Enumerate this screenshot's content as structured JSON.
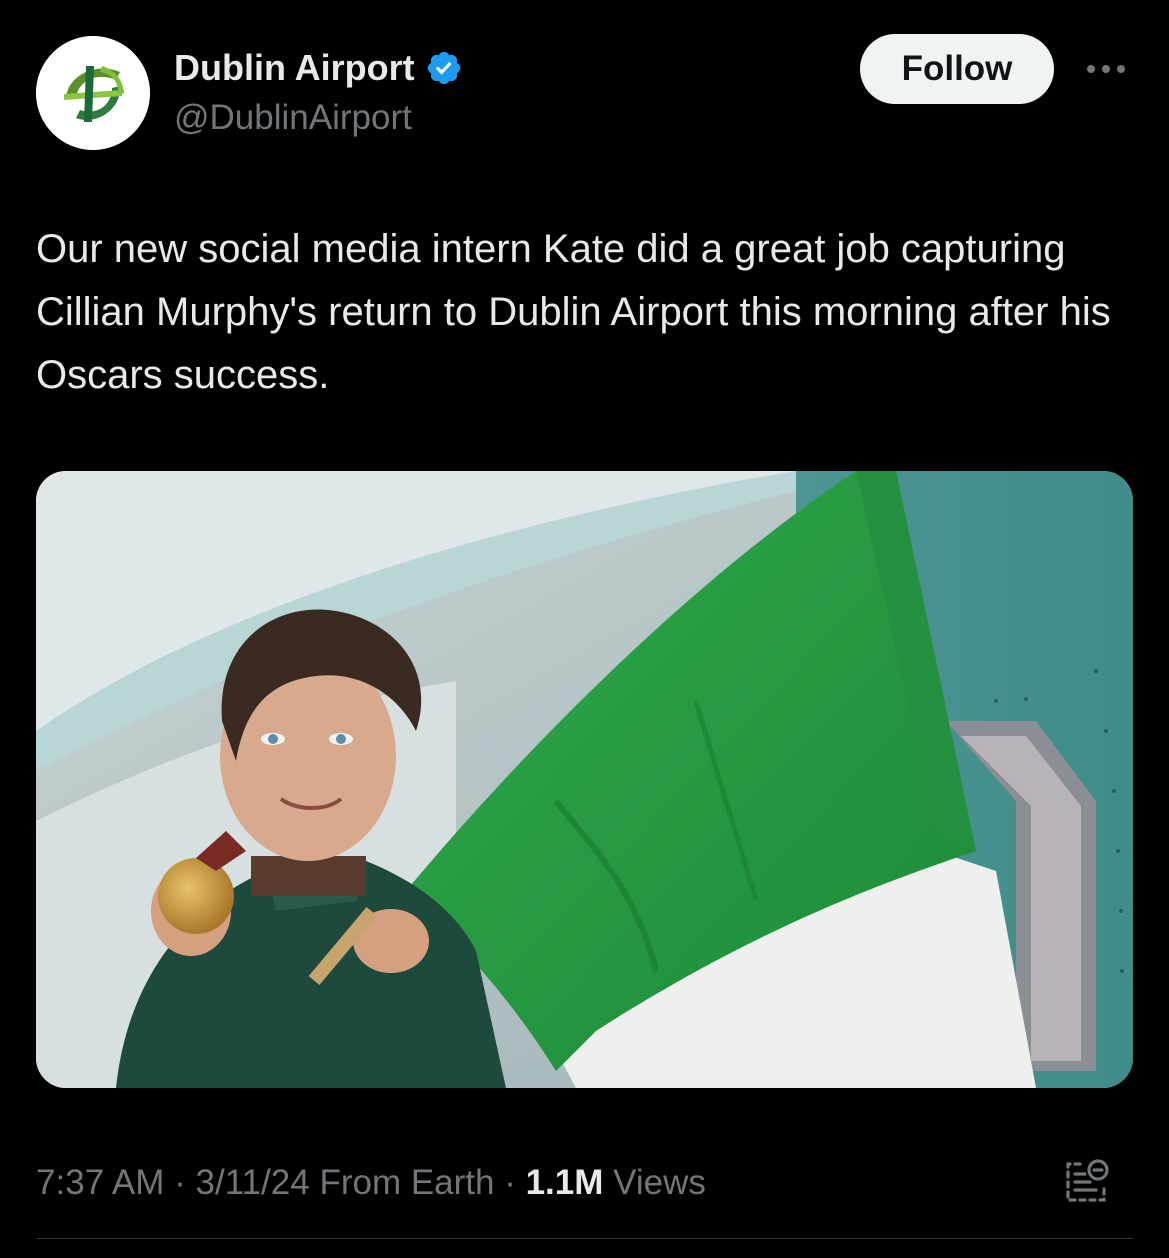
{
  "author": {
    "display_name": "Dublin Airport",
    "handle": "@DublinAirport",
    "verified": true,
    "avatar_icon": "dublin-airport-logo-icon"
  },
  "actions": {
    "follow_label": "Follow",
    "more_icon": "more-options-icon"
  },
  "tweet": {
    "text": "Our new social media intern Kate did a great job capturing Cillian Murphy's return to Dublin Airport this morning after his Oscars success."
  },
  "media": {
    "description_icon": "photo-image"
  },
  "meta": {
    "time": "7:37 AM",
    "separator_1": " · ",
    "date": "3/11/24",
    "source": " From Earth",
    "separator_2": " · ",
    "views_count": "1.1M",
    "views_label": " Views",
    "analytics_icon": "analytics-icon"
  },
  "colors": {
    "background": "#000000",
    "text_primary": "#e7e9ea",
    "text_secondary": "#71767b",
    "verified_blue": "#1d9bf0",
    "follow_bg": "#eff3f4"
  }
}
